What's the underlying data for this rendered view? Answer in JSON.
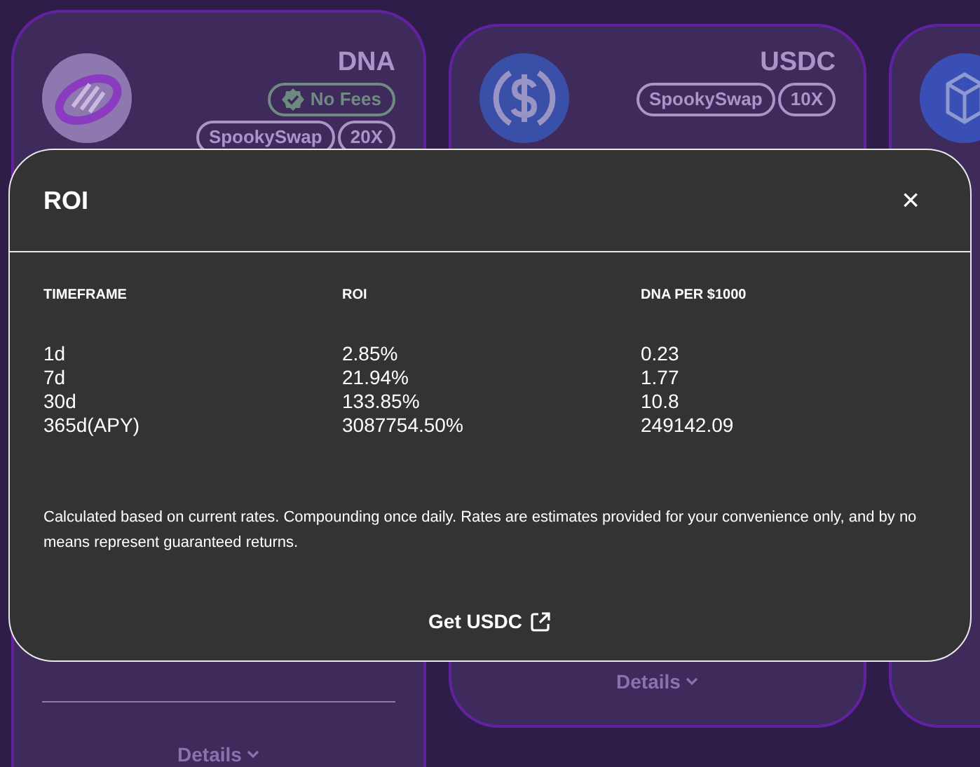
{
  "cards": [
    {
      "kind": "dna",
      "token": "DNA",
      "badges": [
        {
          "kind": "verified",
          "label": "No Fees"
        }
      ],
      "tags": [
        "SpookySwap",
        "20X"
      ],
      "divider": true,
      "details": "Details"
    },
    {
      "kind": "usdc",
      "token": "USDC",
      "tags": [
        "SpookySwap",
        "10X"
      ],
      "details": "Details"
    },
    {
      "kind": "fantom"
    }
  ],
  "modal": {
    "title": "ROI",
    "close": "×",
    "columns": [
      "TIMEFRAME",
      "ROI",
      "DNA PER $1000"
    ],
    "rows": [
      [
        "1d",
        "2.85%",
        "0.23"
      ],
      [
        "7d",
        "21.94%",
        "1.77"
      ],
      [
        "30d",
        "133.85%",
        "10.8"
      ],
      [
        "365d(APY)",
        "3087754.50%",
        "249142.09"
      ]
    ],
    "note": "Calculated based on current rates. Compounding once daily. Rates are estimates provided for your convenience only, and by no means represent guaranteed returns.",
    "link": "Get USDC"
  }
}
